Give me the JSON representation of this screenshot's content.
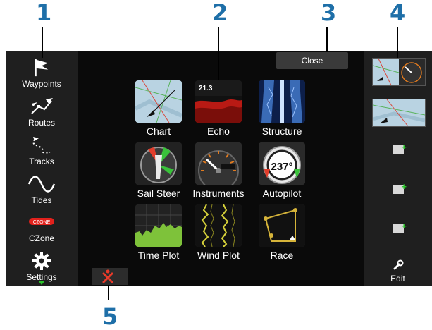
{
  "callouts": [
    "1",
    "2",
    "3",
    "4",
    "5"
  ],
  "sidebar": {
    "items": [
      {
        "label": "Waypoints",
        "icon": "flag-icon"
      },
      {
        "label": "Routes",
        "icon": "route-icon"
      },
      {
        "label": "Tracks",
        "icon": "track-icon"
      },
      {
        "label": "Tides",
        "icon": "wave-icon"
      },
      {
        "label": "CZone",
        "icon": "czone-icon",
        "logo_text": "CZONE"
      },
      {
        "label": "Settings",
        "icon": "gear-icon"
      }
    ]
  },
  "header": {
    "close_label": "Close"
  },
  "apps": [
    {
      "label": "Chart",
      "icon": "chart-app-icon"
    },
    {
      "label": "Echo",
      "icon": "echo-app-icon",
      "depth": "21.3"
    },
    {
      "label": "Structure",
      "icon": "structure-app-icon"
    },
    {
      "label": "Sail Steer",
      "icon": "sail-steer-app-icon"
    },
    {
      "label": "Instruments",
      "icon": "instruments-app-icon"
    },
    {
      "label": "Autopilot",
      "icon": "autopilot-app-icon",
      "heading": "237°"
    },
    {
      "label": "Time Plot",
      "icon": "time-plot-app-icon"
    },
    {
      "label": "Wind Plot",
      "icon": "wind-plot-app-icon"
    },
    {
      "label": "Race",
      "icon": "race-app-icon"
    }
  ],
  "right_panel": {
    "edit_label": "Edit"
  },
  "colors": {
    "callout": "#1e6fa8",
    "add_plus": "#2bc42b",
    "mob": "#e83a2a"
  }
}
